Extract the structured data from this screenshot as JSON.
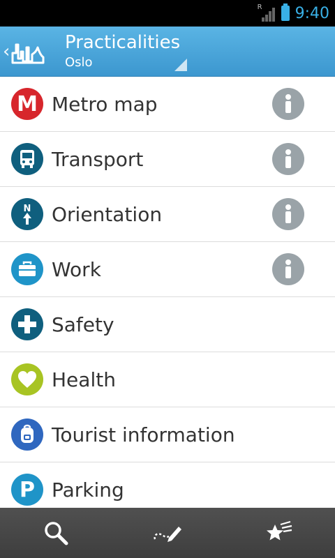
{
  "status_bar": {
    "time": "9:40",
    "roaming_indicator": "R"
  },
  "action_bar": {
    "title": "Practicalities",
    "subtitle": "Oslo",
    "back_icon": "chevron-left-icon",
    "logo_icon": "city-skyline-logo"
  },
  "colors": {
    "accent": "#3c97cf",
    "info_gray": "#9aa3a8",
    "divider": "#dcdcdc"
  },
  "list": {
    "items": [
      {
        "label": "Metro map",
        "icon": "metro-m-icon",
        "color": "#d7262c",
        "has_info": true
      },
      {
        "label": "Transport",
        "icon": "bus-icon",
        "color": "#0f5f7e",
        "has_info": true
      },
      {
        "label": "Orientation",
        "icon": "north-arrow-icon",
        "color": "#0f5f7e",
        "has_info": true
      },
      {
        "label": "Work",
        "icon": "briefcase-icon",
        "color": "#1f94c8",
        "has_info": true
      },
      {
        "label": "Safety",
        "icon": "cross-icon",
        "color": "#0f5f7e",
        "has_info": false
      },
      {
        "label": "Health",
        "icon": "heart-icon",
        "color": "#a8c423",
        "has_info": false
      },
      {
        "label": "Tourist information",
        "icon": "backpack-icon",
        "color": "#2f67bf",
        "has_info": false
      },
      {
        "label": "Parking",
        "icon": "parking-p-icon",
        "color": "#1f94c8",
        "has_info": false
      }
    ]
  },
  "bottom_bar": {
    "buttons": [
      "search-icon",
      "route-pencil-icon",
      "starred-icon"
    ]
  }
}
